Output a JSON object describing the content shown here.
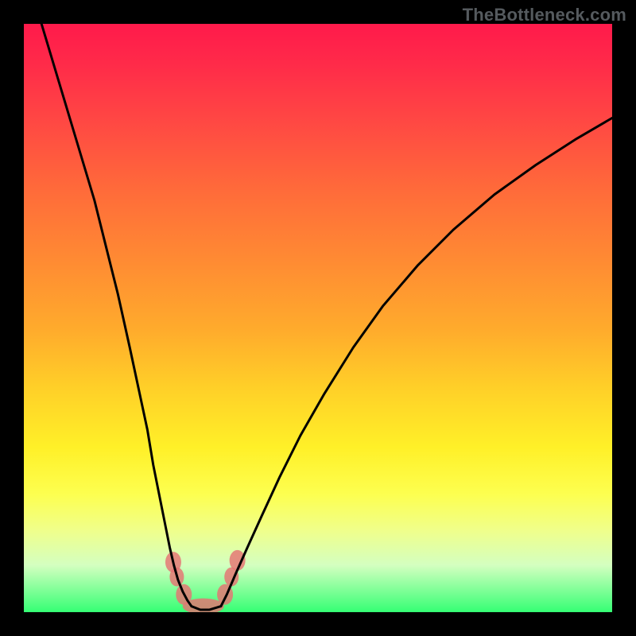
{
  "watermark": "TheBottleneck.com",
  "chart_data": {
    "type": "line",
    "title": "",
    "xlabel": "",
    "ylabel": "",
    "xlim": [
      0,
      100
    ],
    "ylim": [
      0,
      100
    ],
    "series": [
      {
        "name": "left-curve",
        "x": [
          3,
          6,
          9,
          12,
          14,
          16,
          18,
          19.5,
          21,
          22,
          23,
          24,
          24.8,
          25.5,
          26.2,
          27,
          27.8,
          28.5
        ],
        "y": [
          100,
          90,
          80,
          70,
          62,
          54,
          45,
          38,
          31,
          25,
          20,
          15,
          11,
          8,
          5.5,
          3.5,
          2,
          1
        ]
      },
      {
        "name": "right-curve",
        "x": [
          33.5,
          34.5,
          36,
          38,
          40.5,
          43.5,
          47,
          51,
          56,
          61,
          67,
          73,
          80,
          87,
          94,
          100
        ],
        "y": [
          1,
          3,
          6.5,
          11,
          16.5,
          23,
          30,
          37,
          45,
          52,
          59,
          65,
          71,
          76,
          80.5,
          84
        ]
      },
      {
        "name": "floor",
        "x": [
          28.5,
          30,
          31.5,
          33.5
        ],
        "y": [
          1,
          0.4,
          0.4,
          1
        ]
      }
    ],
    "markers": [
      {
        "name": "left-cluster-top",
        "approx_x": 25.4,
        "approx_y": 8.5
      },
      {
        "name": "left-cluster-mid",
        "approx_x": 26.0,
        "approx_y": 6.0
      },
      {
        "name": "left-cluster-bottom",
        "approx_x": 27.2,
        "approx_y": 3.0
      },
      {
        "name": "floor-blob",
        "approx_x": 30.5,
        "approx_y": 1.0
      },
      {
        "name": "right-cluster-bottom",
        "approx_x": 34.2,
        "approx_y": 3.0
      },
      {
        "name": "right-cluster-mid",
        "approx_x": 35.3,
        "approx_y": 6.0
      },
      {
        "name": "right-cluster-top",
        "approx_x": 36.3,
        "approx_y": 8.8
      }
    ],
    "colors": {
      "background_frame": "#000000",
      "curve": "#000000",
      "markers": "#e57373",
      "gradient_top": "#ff1a4b",
      "gradient_mid": "#ffe028",
      "gradient_bottom": "#35ff74"
    }
  }
}
